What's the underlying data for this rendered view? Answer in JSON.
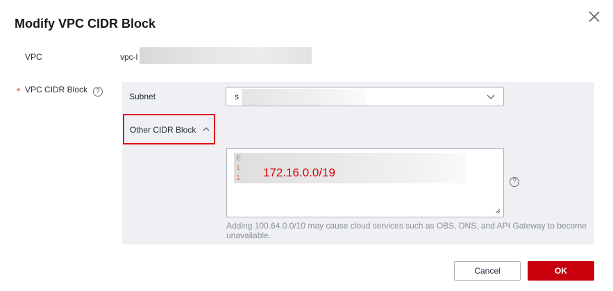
{
  "dialog": {
    "title": "Modify VPC CIDR Block",
    "close_icon": "close-icon"
  },
  "vpc": {
    "label": "VPC",
    "value_prefix": "vpc-l"
  },
  "cidr_block": {
    "label": "VPC CIDR Block",
    "required_mark": "*",
    "help_icon": "question-circle-icon",
    "help_glyph": "?"
  },
  "subnet": {
    "label": "Subnet",
    "selected_prefix": "s",
    "chevron_icon": "chevron-down-icon"
  },
  "other_cidr": {
    "label": "Other CIDR Block",
    "chevron_icon": "chevron-up-icon",
    "expanded": true
  },
  "textarea": {
    "line1": "E",
    "line2": "1",
    "line3": "1",
    "annotation_value": "172.16.0.0/19",
    "help_icon": "question-circle-icon",
    "help_glyph": "?"
  },
  "hint": "Adding 100.64.0.0/10 may cause cloud services such as OBS, DNS, and API Gateway to become unavailable.",
  "buttons": {
    "cancel": "Cancel",
    "ok": "OK"
  },
  "colors": {
    "primary": "#c7000b",
    "annotation": "#e00000",
    "panel_bg": "#eff0f4"
  }
}
